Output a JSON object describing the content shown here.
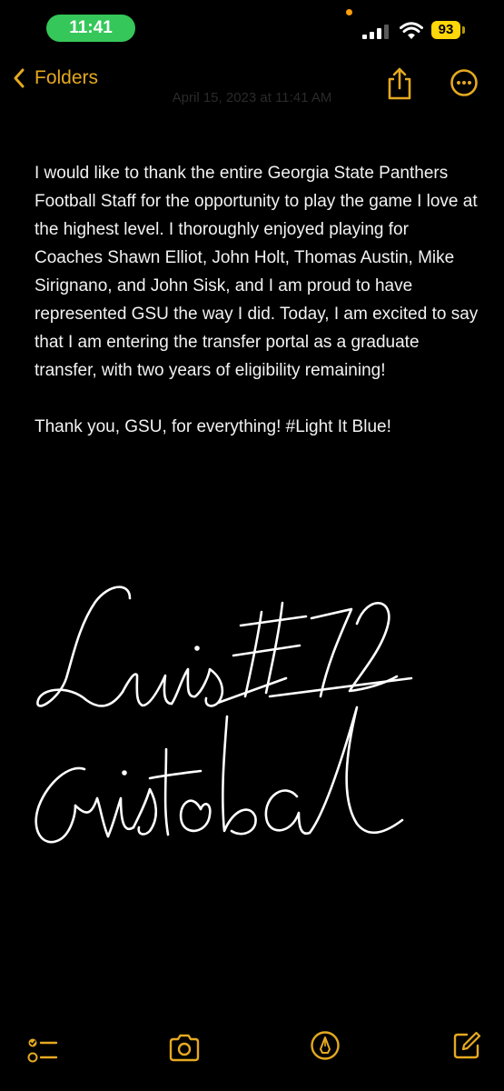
{
  "status_bar": {
    "time": "11:41",
    "battery": "93",
    "colors": {
      "time_pill": "#35c759",
      "battery": "#ffd60a",
      "privacy_dot": "#ff9f0a"
    },
    "icons": [
      "cellular-signal-icon",
      "wifi-icon",
      "battery-icon"
    ]
  },
  "nav": {
    "back_label": "Folders",
    "accent": "#e5a921",
    "icons": [
      "chevron-left-icon",
      "share-icon",
      "more-icon"
    ]
  },
  "note": {
    "date": "April 15, 2023 at 11:41 AM",
    "paragraph_1": "I would like to thank the entire Georgia State Panthers Football Staff for the opportunity to play the game I love at the highest level.  I thoroughly enjoyed playing for Coaches Shawn Elliot, John Holt, Thomas Austin, Mike Sirignano, and John Sisk, and I am proud to have represented GSU the way I did.  Today, I am excited to say that I am entering the transfer portal as a graduate transfer, with two years of eligibility remaining!",
    "paragraph_2": "Thank you, GSU, for everything!  #Light It Blue!",
    "signature": "Luis #72 Cristobal"
  },
  "toolbar": {
    "icons": [
      "checklist-icon",
      "camera-icon",
      "markup-icon",
      "compose-icon"
    ]
  }
}
